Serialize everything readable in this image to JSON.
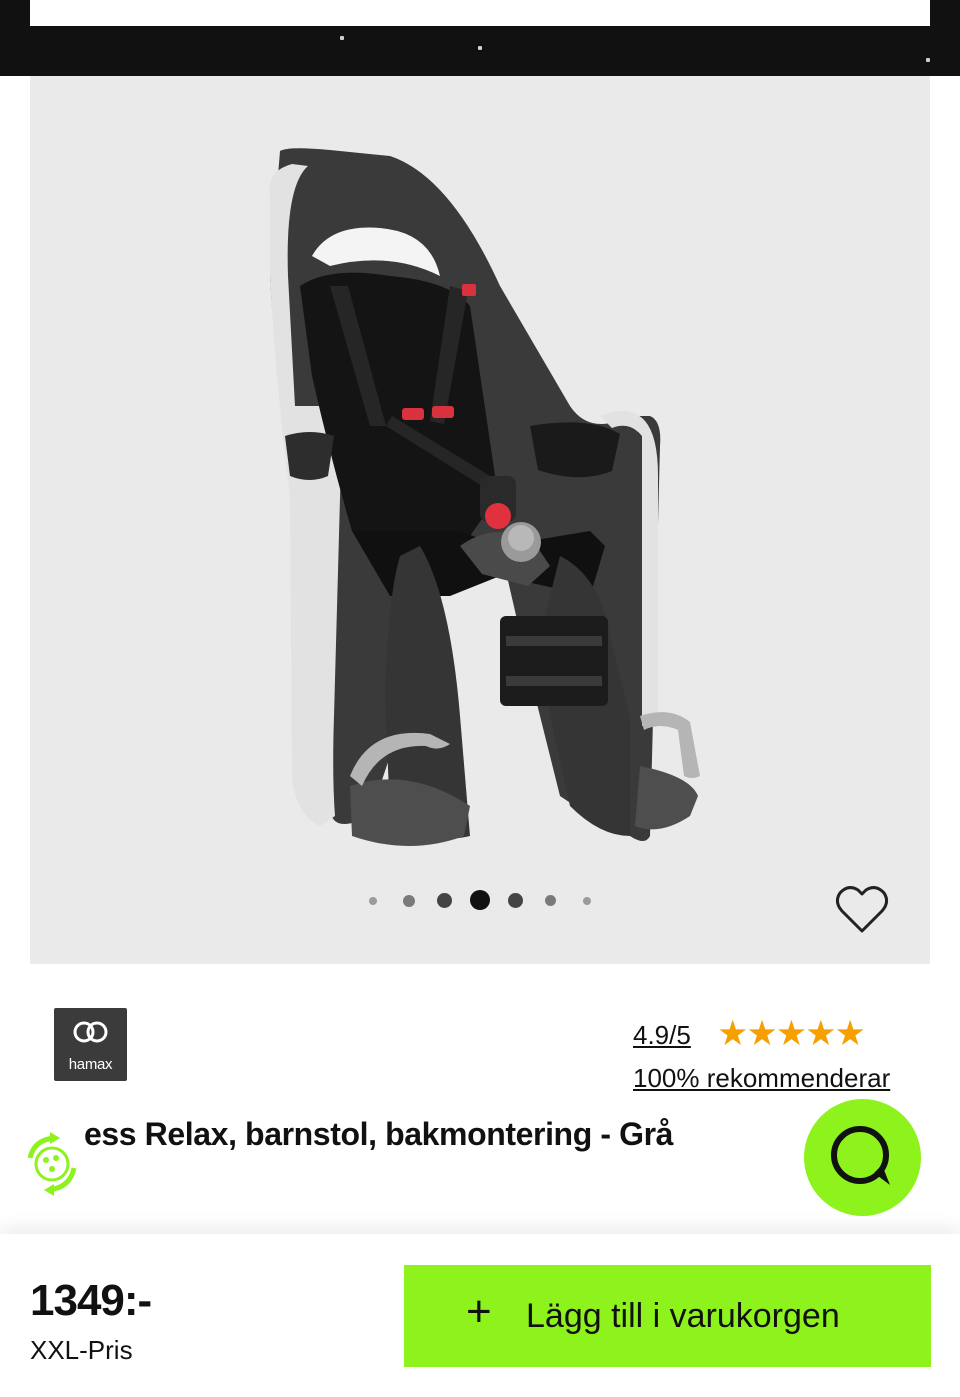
{
  "product": {
    "brand": "hamax",
    "title": "ess Relax, barnstol, bakmontering - Grå",
    "image_alt": "Hamax barnstol"
  },
  "gallery": {
    "total_slides": 7,
    "active_index": 3
  },
  "rating": {
    "score": "4.9/5",
    "stars": "★★★★★",
    "star_value": 5,
    "recommend": "100% rekommenderar"
  },
  "purchase": {
    "price": "1349:-",
    "price_label": "XXL-Pris",
    "add_to_cart": "Lägg till i varukorgen",
    "add_icon": "+"
  },
  "icons": {
    "favorite": "heart-icon",
    "chat": "chat-icon",
    "recycle": "recycle-icon",
    "add": "plus-icon"
  },
  "colors": {
    "accent": "#8ef21c",
    "stars": "#f5a000",
    "image_bg": "#eaeaeb",
    "brand_bg": "#3b3b3b"
  }
}
